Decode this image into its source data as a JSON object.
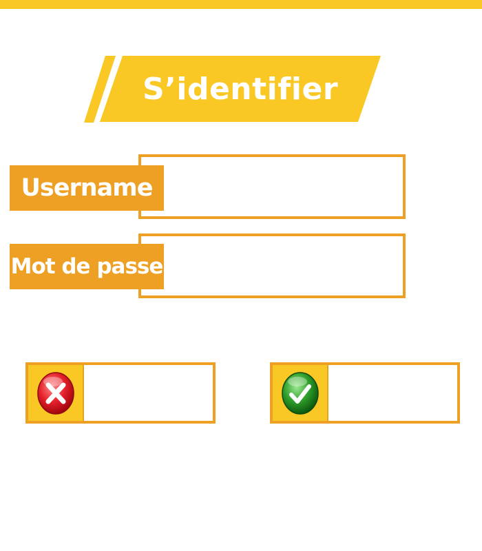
{
  "title": "S’identifier",
  "form": {
    "username": {
      "label": "Username",
      "value": "",
      "placeholder": ""
    },
    "password": {
      "label": "Mot de passe",
      "value": "",
      "placeholder": ""
    }
  },
  "buttons": {
    "cancel": {
      "label": "",
      "icon": "cancel-x-icon"
    },
    "confirm": {
      "label": "",
      "icon": "confirm-check-icon"
    }
  },
  "colors": {
    "primary_yellow": "#f9c824",
    "accent_orange": "#eea024",
    "cancel_red": "#e5212b",
    "confirm_green": "#2e9e2a"
  }
}
